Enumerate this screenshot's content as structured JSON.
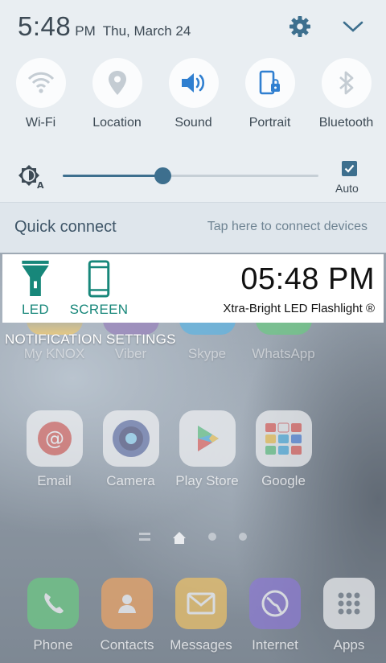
{
  "status": {
    "time": "5:48",
    "ampm": "PM",
    "date": "Thu, March 24"
  },
  "quick_toggles": [
    {
      "label": "Wi-Fi",
      "icon": "wifi-icon"
    },
    {
      "label": "Location",
      "icon": "location-pin-icon"
    },
    {
      "label": "Sound",
      "icon": "speaker-icon"
    },
    {
      "label": "Portrait",
      "icon": "portrait-lock-icon"
    },
    {
      "label": "Bluetooth",
      "icon": "bluetooth-icon"
    }
  ],
  "brightness": {
    "level_fraction": 0.39,
    "auto_label": "Auto",
    "auto_checked": true
  },
  "quick_connect": {
    "title": "Quick connect",
    "hint": "Tap here to connect devices"
  },
  "flashlight_notification": {
    "led_label": "LED",
    "screen_label": "SCREEN",
    "time": "05:48 PM",
    "app_name": "Xtra-Bright LED Flashlight ®",
    "accent": "#17877a"
  },
  "notification_settings_label": "NOTIFICATION SETTINGS",
  "home": {
    "row1": [
      "My KNOX",
      "Viber",
      "Skype",
      "WhatsApp"
    ],
    "row2": [
      "Email",
      "Camera",
      "Play Store",
      "Google"
    ],
    "dock": [
      "Phone",
      "Contacts",
      "Messages",
      "Internet",
      "Apps"
    ]
  },
  "colors": {
    "shade_bg": "#e9eef2",
    "accent_blue": "#3d6f8e",
    "text_dark": "#3d4a55"
  }
}
